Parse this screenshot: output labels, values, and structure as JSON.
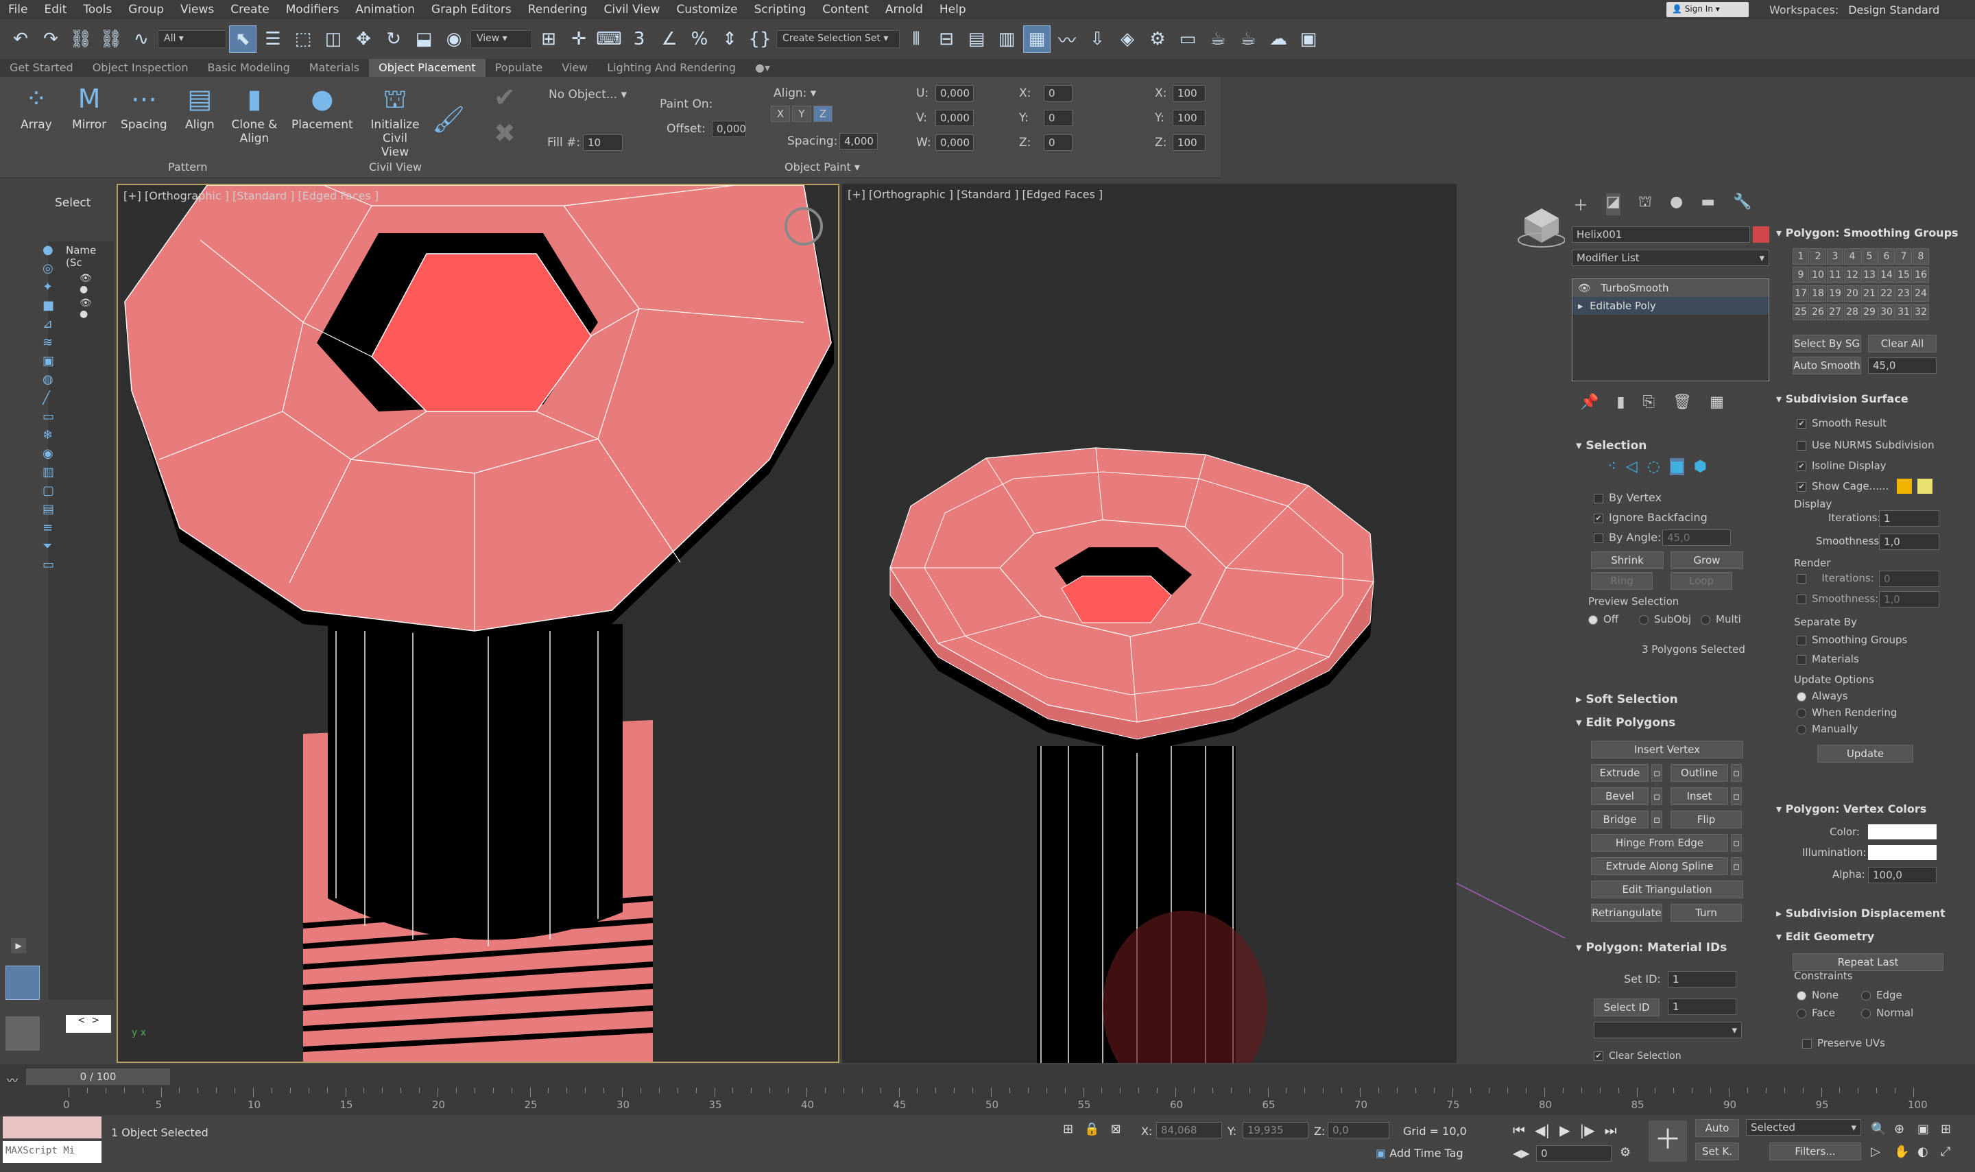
{
  "menu": [
    "File",
    "Edit",
    "Tools",
    "Group",
    "Views",
    "Create",
    "Modifiers",
    "Animation",
    "Graph Editors",
    "Rendering",
    "Civil View",
    "Customize",
    "Scripting",
    "Content",
    "Arnold",
    "Help"
  ],
  "signin": "Sign In",
  "workspace": {
    "label": "Workspaces:",
    "value": "Design Standard"
  },
  "toolbar": {
    "filter": "All",
    "view": "View",
    "selection_set": "Create Selection Set"
  },
  "tabs": [
    "Get Started",
    "Object Inspection",
    "Basic Modeling",
    "Materials",
    "Object Placement",
    "Populate",
    "View",
    "Lighting And Rendering"
  ],
  "ribbon": {
    "buttons": [
      "Array",
      "Mirror",
      "Spacing",
      "Align",
      "Clone & Align",
      "Placement"
    ],
    "pattern_label": "Pattern",
    "civil": "Initialize Civil View",
    "civil_group": "Civil View",
    "no_object": "No Object...",
    "fill": "Fill #:",
    "fill_val": "10",
    "paint_on": "Paint On:",
    "offset": "Offset:",
    "offset_val": "0,000",
    "align": "Align:",
    "xyz": [
      "X",
      "Y",
      "Z"
    ],
    "spacing": "Spacing:",
    "spacing_val": "4,000",
    "object_paint": "Object Paint",
    "u": "U:",
    "v": "V:",
    "w": "W:",
    "uvw_val": "0,000",
    "rx": "X:",
    "ry": "Y:",
    "rz": "Z:",
    "rot_val": "0",
    "sx": "X:",
    "sy": "Y:",
    "sz": "Z:",
    "scale_val": "100"
  },
  "left": {
    "select": "Select",
    "name_col": "Name (Sc"
  },
  "vp1": {
    "label": "[+] [Orthographic ] [Standard ] [Edged Faces ]"
  },
  "vp2": {
    "label": "[+] [Orthographic ] [Standard ] [Edged Faces ]"
  },
  "cmd": {
    "object_name": "Helix001",
    "modifier_list": "Modifier List",
    "stack": [
      "TurboSmooth",
      "Editable Poly"
    ],
    "selection": "Selection",
    "by_vertex": "By Vertex",
    "ignore_backfacing": "Ignore Backfacing",
    "by_angle": "By Angle:",
    "angle_val": "45,0",
    "shrink": "Shrink",
    "grow": "Grow",
    "ring": "Ring",
    "loop": "Loop",
    "preview_selection": "Preview Selection",
    "preview_opts": [
      "Off",
      "SubObj",
      "Multi"
    ],
    "polys_selected": "3 Polygons Selected",
    "soft_selection": "Soft Selection",
    "edit_polygons": "Edit Polygons",
    "insert_vertex": "Insert Vertex",
    "extrude": "Extrude",
    "outline": "Outline",
    "bevel": "Bevel",
    "inset": "Inset",
    "bridge": "Bridge",
    "flip": "Flip",
    "hinge": "Hinge From Edge",
    "extrude_spline": "Extrude Along Spline",
    "edit_tri": "Edit Triangulation",
    "retri": "Retriangulate",
    "turn": "Turn",
    "mat_ids": "Polygon: Material IDs",
    "set_id": "Set ID:",
    "select_id": "Select ID",
    "id_val": "1",
    "clear_selection": "Clear Selection"
  },
  "col2": {
    "smoothing": "Polygon: Smoothing Groups",
    "sg": [
      "1",
      "2",
      "3",
      "4",
      "5",
      "6",
      "7",
      "8",
      "9",
      "10",
      "11",
      "12",
      "13",
      "14",
      "15",
      "16",
      "17",
      "18",
      "19",
      "20",
      "21",
      "22",
      "23",
      "24",
      "25",
      "26",
      "27",
      "28",
      "29",
      "30",
      "31",
      "32"
    ],
    "select_by_sg": "Select By SG",
    "clear_all": "Clear All",
    "auto_smooth": "Auto Smooth",
    "auto_val": "45,0",
    "subdiv": "Subdivision Surface",
    "smooth_result": "Smooth Result",
    "nurms": "Use NURMS Subdivision",
    "isoline": "Isoline Display",
    "show_cage": "Show Cage......",
    "display": "Display",
    "iterations": "Iterations:",
    "iter_val": "1",
    "iter_val_r": "0",
    "smoothness": "Smoothness:",
    "smooth_val": "1,0",
    "render": "Render",
    "separate_by": "Separate By",
    "smoothing_groups": "Smoothing Groups",
    "materials": "Materials",
    "update_options": "Update Options",
    "always": "Always",
    "when_rendering": "When Rendering",
    "manually": "Manually",
    "update": "Update",
    "vertex_colors": "Polygon: Vertex Colors",
    "color": "Color:",
    "illumination": "Illumination:",
    "alpha": "Alpha:",
    "alpha_val": "100,0",
    "subdiv_disp": "Subdivision Displacement",
    "edit_geom": "Edit Geometry",
    "repeat_last": "Repeat Last",
    "constraints": "Constraints",
    "none": "None",
    "edge": "Edge",
    "face": "Face",
    "normal": "Normal",
    "preserve_uvs": "Preserve UVs"
  },
  "timeline": {
    "frame": "0 / 100",
    "ticks": [
      "0",
      "5",
      "10",
      "15",
      "20",
      "25",
      "30",
      "35",
      "40",
      "45",
      "50",
      "55",
      "60",
      "65",
      "70",
      "75",
      "80",
      "85",
      "90",
      "95",
      "100"
    ]
  },
  "status": {
    "maxscript": "MAXScript Mi",
    "selected": "1 Object Selected",
    "x": "X:",
    "x_val": "84,068",
    "y": "Y:",
    "y_val": "19,935",
    "z": "Z:",
    "z_val": "0,0",
    "grid": "Grid = 10,0",
    "add_time_tag": "Add Time Tag",
    "auto": "Auto",
    "set_k": "Set K.",
    "selected_dd": "Selected",
    "filters": "Filters...",
    "frame_val": "0"
  },
  "colors": {
    "object": "#e87c7c",
    "selected_face": "#ff5a5a",
    "swatch_red": "#d04848",
    "cage1": "#f0b400",
    "cage2": "#e8e070"
  }
}
